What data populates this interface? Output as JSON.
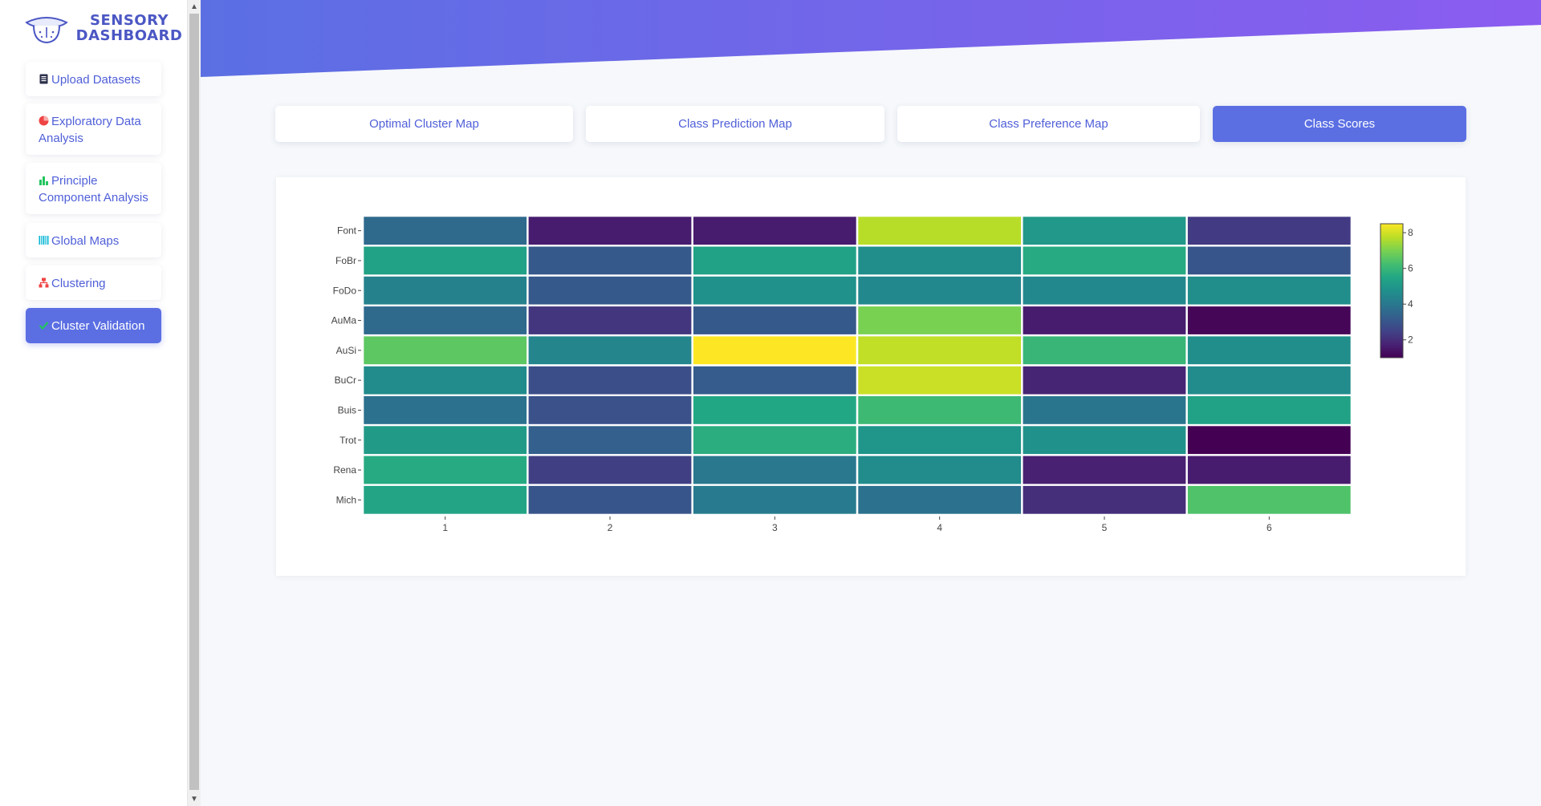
{
  "sidebar": {
    "logo_line1": "SENSORY",
    "logo_line2": "DASHBOARD",
    "items": [
      {
        "label": "Upload Datasets",
        "icon": "file-icon",
        "color": "#2b2f4a"
      },
      {
        "label": "Exploratory Data Analysis",
        "icon": "pie-chart-icon",
        "color": "#ef4444"
      },
      {
        "label": "Principle Component Analysis",
        "icon": "bar-chart-icon",
        "color": "#22c55e"
      },
      {
        "label": "Global Maps",
        "icon": "barcode-icon",
        "color": "#06b6d4"
      },
      {
        "label": "Clustering",
        "icon": "sitemap-icon",
        "color": "#ef4444"
      },
      {
        "label": "Cluster Validation",
        "icon": "check-icon",
        "color": "#22c55e"
      }
    ],
    "active_index": 5
  },
  "tabs": [
    {
      "label": "Optimal Cluster Map"
    },
    {
      "label": "Class Prediction Map"
    },
    {
      "label": "Class Preference Map"
    },
    {
      "label": "Class Scores"
    }
  ],
  "active_tab": 3,
  "colors": {
    "accent": "#5b6fe3",
    "header_gradient_start": "#5b6fe3",
    "header_gradient_end": "#8b5cf0"
  },
  "chart_data": {
    "type": "heatmap",
    "colorscale": "viridis",
    "x": [
      "1",
      "2",
      "3",
      "4",
      "5",
      "6"
    ],
    "y": [
      "Font",
      "FoBr",
      "FoDo",
      "AuMa",
      "AuSi",
      "BuCr",
      "Buis",
      "Trot",
      "Rena",
      "Mich"
    ],
    "z": [
      [
        3.6,
        1.6,
        1.6,
        7.7,
        5.0,
        2.3
      ],
      [
        5.3,
        3.1,
        5.3,
        4.7,
        5.6,
        3.0
      ],
      [
        4.3,
        3.1,
        4.8,
        4.5,
        4.5,
        4.7
      ],
      [
        3.6,
        2.2,
        3.1,
        7.0,
        1.6,
        1.1
      ],
      [
        6.6,
        4.4,
        8.5,
        7.8,
        6.0,
        4.7
      ],
      [
        4.6,
        2.8,
        3.2,
        7.9,
        1.8,
        4.6
      ],
      [
        3.8,
        2.9,
        5.5,
        6.1,
        3.9,
        5.3
      ],
      [
        5.1,
        3.3,
        5.7,
        4.9,
        4.8,
        1.0
      ],
      [
        5.6,
        2.4,
        4.0,
        4.6,
        1.7,
        1.6
      ],
      [
        5.4,
        3.0,
        4.1,
        3.8,
        2.0,
        6.4
      ]
    ],
    "zmin": 1.0,
    "zmax": 8.5,
    "colorbar_ticks": [
      2,
      4,
      6,
      8
    ],
    "legend_position": "right",
    "title": "",
    "xlabel": "",
    "ylabel": ""
  }
}
